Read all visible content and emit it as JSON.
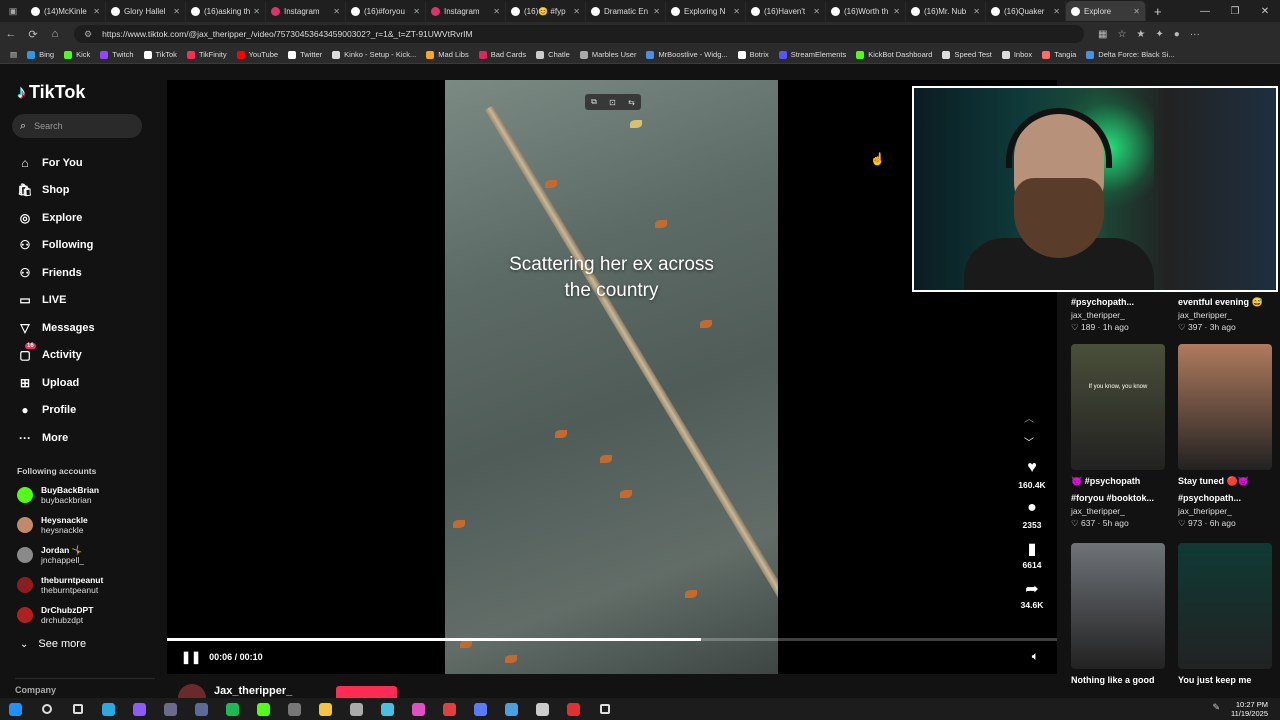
{
  "browser": {
    "tabs": [
      {
        "label": "(14)McKinle",
        "color": "#ffffff"
      },
      {
        "label": "Glory Hallel",
        "color": "#ffffff"
      },
      {
        "label": "(16)asking th",
        "color": "#ffffff"
      },
      {
        "label": "Instagram",
        "color": "#e1306c"
      },
      {
        "label": "(16)#foryou",
        "color": "#ffffff"
      },
      {
        "label": "Instagram",
        "color": "#e1306c"
      },
      {
        "label": "(16)😊 #fyp",
        "color": "#ffffff"
      },
      {
        "label": "Dramatic En",
        "color": "#ffffff"
      },
      {
        "label": "Exploring N",
        "color": "#ffffff"
      },
      {
        "label": "(16)Haven't",
        "color": "#ffffff"
      },
      {
        "label": "(16)Worth th",
        "color": "#ffffff"
      },
      {
        "label": "(16)Mr. Nub",
        "color": "#ffffff"
      },
      {
        "label": "(16)Quaker",
        "color": "#ffffff"
      },
      {
        "label": "Explore",
        "color": "#ffffff"
      }
    ],
    "new_tab": "+",
    "url": "https://www.tiktok.com/@jax_theripper_/video/7573045364345900302?_r=1&_t=ZT-91UWVtRvrIM",
    "bookmarks": [
      {
        "label": "Bing",
        "color": "#2b9ae6"
      },
      {
        "label": "Kick",
        "color": "#53fc18"
      },
      {
        "label": "Twitch",
        "color": "#9146ff"
      },
      {
        "label": "TikTok",
        "color": "#ffffff"
      },
      {
        "label": "TikFinity",
        "color": "#fe2c55"
      },
      {
        "label": "YouTube",
        "color": "#ff0000"
      },
      {
        "label": "Twitter",
        "color": "#ffffff"
      },
      {
        "label": "Kinko - Setup - Kick...",
        "color": "#dddddd"
      },
      {
        "label": "Mad Libs",
        "color": "#f5a623"
      },
      {
        "label": "Bad Cards",
        "color": "#e0245e"
      },
      {
        "label": "Chatle",
        "color": "#cccccc"
      },
      {
        "label": "Marbles User",
        "color": "#aaaaaa"
      },
      {
        "label": "MrBoostlive - Widg...",
        "color": "#4a90e2"
      },
      {
        "label": "Botrix",
        "color": "#ffffff"
      },
      {
        "label": "StreamElements",
        "color": "#5c52ff"
      },
      {
        "label": "KickBot Dashboard",
        "color": "#53fc18"
      },
      {
        "label": "Speed Test",
        "color": "#dddddd"
      },
      {
        "label": "Inbox",
        "color": "#dddddd"
      },
      {
        "label": "Tangia",
        "color": "#ff6b6b"
      },
      {
        "label": "Delta Force: Black Si...",
        "color": "#4a90e2"
      }
    ]
  },
  "tiktok": {
    "logo": "TikTok",
    "search_placeholder": "Search",
    "nav": [
      {
        "label": "For You",
        "icon": "home-icon",
        "glyph": "⌂"
      },
      {
        "label": "Shop",
        "icon": "shop-icon",
        "glyph": "🛍"
      },
      {
        "label": "Explore",
        "icon": "compass-icon",
        "glyph": "◎"
      },
      {
        "label": "Following",
        "icon": "following-icon",
        "glyph": "⚇"
      },
      {
        "label": "Friends",
        "icon": "friends-icon",
        "glyph": "⚇"
      },
      {
        "label": "LIVE",
        "icon": "live-icon",
        "glyph": "▭"
      },
      {
        "label": "Messages",
        "icon": "messages-icon",
        "glyph": "▽"
      },
      {
        "label": "Activity",
        "icon": "activity-icon",
        "glyph": "▢",
        "badge": "16"
      },
      {
        "label": "Upload",
        "icon": "upload-icon",
        "glyph": "⊞"
      },
      {
        "label": "Profile",
        "icon": "profile-icon",
        "glyph": "●"
      },
      {
        "label": "More",
        "icon": "more-icon",
        "glyph": "···"
      }
    ],
    "following_heading": "Following accounts",
    "following": [
      {
        "name": "BuyBackBrian",
        "handle": "buybackbrian",
        "color": "#53fc18"
      },
      {
        "name": "Heysnackle",
        "handle": "heysnackle",
        "color": "#c28a6a"
      },
      {
        "name": "Jordan 🤸",
        "handle": "jnchappell_",
        "color": "#8a8a8a"
      },
      {
        "name": "theburntpeanut",
        "handle": "theburntpeanut",
        "color": "#8b1e1e"
      },
      {
        "name": "DrChubzDPT",
        "handle": "drchubzdpt",
        "color": "#b02020"
      }
    ],
    "see_more": "See more",
    "company": "Company"
  },
  "video": {
    "caption_line1": "Scattering her ex across",
    "caption_line2": "the country",
    "time": "00:06 / 00:10",
    "progress": 0.6,
    "author": "Jax_theripper_",
    "likes": "160.4K",
    "comments": "2353",
    "saves": "6614",
    "shares": "34.6K"
  },
  "grid": [
    {
      "title": "#psychopath...",
      "author": "jax_theripper_",
      "likes": "189",
      "age": "1h ago",
      "hidden_thumb": true
    },
    {
      "title": "eventful evening 😅",
      "author": "jax_theripper_",
      "likes": "397",
      "age": "3h ago",
      "hidden_thumb": true
    },
    {
      "title": "😈 #psychopath",
      "title2": "#foryou #booktok...",
      "author": "jax_theripper_",
      "likes": "637",
      "age": "5h ago",
      "thumb_text": "If you know, you know",
      "thumb_color": "#4a4f3a"
    },
    {
      "title": "Stay tuned 🔴😈",
      "title2": "#psychopath...",
      "author": "jax_theripper_",
      "likes": "973",
      "age": "6h ago",
      "thumb_color": "#b07a5e"
    },
    {
      "title": "Nothing like a good",
      "author": "",
      "likes": "",
      "age": "",
      "thumb_color": "#6e7378"
    },
    {
      "title": "You just keep me",
      "author": "",
      "likes": "",
      "age": "",
      "thumb_color": "#0f3a34"
    }
  ],
  "taskbar": {
    "clock_time": "10:27 PM",
    "clock_date": "11/19/2025",
    "apps": [
      {
        "name": "windows-start-icon",
        "color": "#1e90ff"
      },
      {
        "name": "search-icon",
        "color": "#dddddd"
      },
      {
        "name": "task-view-icon",
        "color": "#dddddd"
      },
      {
        "name": "edge-icon",
        "color": "#2ba8e0"
      },
      {
        "name": "chrome-icon",
        "color": "#8b5cf6"
      },
      {
        "name": "obs-icon",
        "color": "#6a6a8a"
      },
      {
        "name": "app-icon",
        "color": "#5a6a9a"
      },
      {
        "name": "spotify-icon",
        "color": "#1db954"
      },
      {
        "name": "kick-icon",
        "color": "#53fc18"
      },
      {
        "name": "app-icon",
        "color": "#777777"
      },
      {
        "name": "file-explorer-icon",
        "color": "#f5c542"
      },
      {
        "name": "app-icon",
        "color": "#aaaaaa"
      },
      {
        "name": "app-icon",
        "color": "#4ac0e0"
      },
      {
        "name": "app-icon",
        "color": "#e050c0"
      },
      {
        "name": "app-icon",
        "color": "#e04040"
      },
      {
        "name": "app-icon",
        "color": "#5a7aff"
      },
      {
        "name": "app-icon",
        "color": "#4aa0e0"
      },
      {
        "name": "app-icon",
        "color": "#cccccc"
      },
      {
        "name": "app-icon",
        "color": "#e03030"
      },
      {
        "name": "settings-icon",
        "color": "#dddddd"
      }
    ]
  }
}
